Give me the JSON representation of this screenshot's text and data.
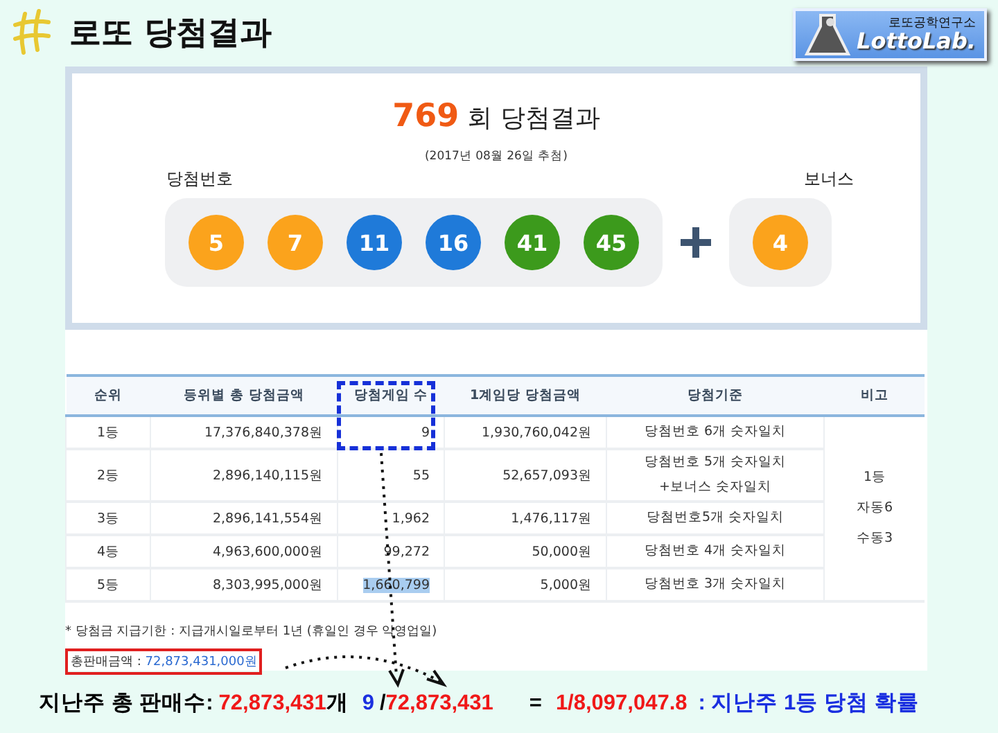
{
  "header": {
    "title": "로또 당첨결과"
  },
  "logo": {
    "caption": "로또공학연구소",
    "name": "LottoLab."
  },
  "draw": {
    "round": "769",
    "title": "회 당첨결과",
    "date": "(2017년 08월 26일 추첨)",
    "numbers_label": "당첨번호",
    "bonus_label": "보너스",
    "numbers": [
      {
        "value": "5",
        "color": "#fba31c"
      },
      {
        "value": "7",
        "color": "#fba31c"
      },
      {
        "value": "11",
        "color": "#1f7ad9"
      },
      {
        "value": "16",
        "color": "#1f7ad9"
      },
      {
        "value": "41",
        "color": "#3c9a1c"
      },
      {
        "value": "45",
        "color": "#3c9a1c"
      }
    ],
    "bonus": {
      "value": "4",
      "color": "#fba31c"
    }
  },
  "table": {
    "columns": [
      "순위",
      "등위별 총 당첨금액",
      "당첨게임 수",
      "1계임당 당첨금액",
      "당첨기준",
      "비고"
    ],
    "rows": [
      {
        "rank": "1등",
        "total": "17,376,840,378원",
        "winners": "9",
        "winners_selected": false,
        "per_game": "1,930,760,042원",
        "criteria": [
          "당첨번호 6개 숫자일치"
        ]
      },
      {
        "rank": "2등",
        "total": "2,896,140,115원",
        "winners": "55",
        "winners_selected": false,
        "per_game": "52,657,093원",
        "criteria": [
          "당첨번호 5개 숫자일치",
          "+보너스 숫자일치"
        ]
      },
      {
        "rank": "3등",
        "total": "2,896,141,554원",
        "winners": "1,962",
        "winners_selected": false,
        "per_game": "1,476,117원",
        "criteria": [
          "당첨번호5개 숫자일치"
        ]
      },
      {
        "rank": "4등",
        "total": "4,963,600,000원",
        "winners": "99,272",
        "winners_selected": false,
        "per_game": "50,000원",
        "criteria": [
          "당첨번호 4개 숫자일치"
        ]
      },
      {
        "rank": "5등",
        "total": "8,303,995,000원",
        "winners": "1,660,799",
        "winners_selected": true,
        "per_game": "5,000원",
        "criteria": [
          "당첨번호 3개 숫자일치"
        ]
      }
    ],
    "remark": [
      "1등",
      "자동6",
      "수동3"
    ]
  },
  "notes": {
    "deadline": "* 당첨금 지급기한 : 지급개시일로부터 1년 (휴일인 경우 익영업일)",
    "total_sales_label": "총판매금액 :",
    "total_sales": "72,873,431,000원"
  },
  "summary": [
    {
      "text": "지난주 총 판매수:",
      "color": "#000000"
    },
    {
      "text": "72,873,431",
      "color": "#f01818"
    },
    {
      "text": "개",
      "color": "#000000"
    },
    {
      "text": "9",
      "color": "#1a2fe0"
    },
    {
      "text": "/",
      "color": "#000000"
    },
    {
      "text": "72,873,431",
      "color": "#f01818"
    },
    {
      "text": "=",
      "color": "#000000"
    },
    {
      "text": "1/8,097,047.8",
      "color": "#f01818"
    },
    {
      "text": ": 지난주 1등 당첨 확률",
      "color": "#1a2fe0"
    }
  ]
}
